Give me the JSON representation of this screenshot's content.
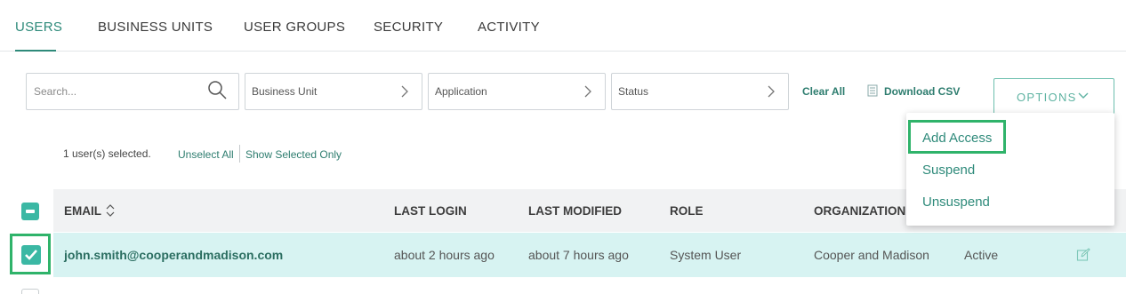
{
  "tabs": [
    {
      "label": "USERS",
      "active": true
    },
    {
      "label": "BUSINESS UNITS",
      "active": false
    },
    {
      "label": "USER GROUPS",
      "active": false
    },
    {
      "label": "SECURITY",
      "active": false
    },
    {
      "label": "ACTIVITY",
      "active": false
    }
  ],
  "filters": {
    "search_placeholder": "Search...",
    "business_unit": "Business Unit",
    "application": "Application",
    "status": "Status",
    "clear_all": "Clear All",
    "download_csv": "Download CSV",
    "options": "OPTIONS"
  },
  "options_menu": {
    "items": [
      "Add Access",
      "Suspend",
      "Unsuspend"
    ]
  },
  "selection": {
    "count_text": "1 user(s) selected.",
    "unselect_all": "Unselect All",
    "show_selected_only": "Show Selected Only"
  },
  "table": {
    "columns": [
      "EMAIL",
      "LAST LOGIN",
      "LAST MODIFIED",
      "ROLE",
      "ORGANIZATION"
    ],
    "rows": [
      {
        "email": "john.smith@cooperandmadison.com",
        "last_login": "about 2 hours ago",
        "last_modified": "about 7 hours ago",
        "role": "System User",
        "organization": "Cooper and Madison",
        "status": "Active",
        "selected": true
      }
    ]
  },
  "icons": {
    "search": "search-icon",
    "chevron": "chevron-right-icon",
    "csv": "document-icon",
    "caret": "chevron-down-icon",
    "sort": "sort-icon",
    "edit": "edit-icon",
    "check": "checkmark-icon"
  },
  "colors": {
    "accent": "#2e8a7a",
    "checkbox": "#3bb8a4",
    "row_selected": "#d7f3f2",
    "highlight": "#2fb36a"
  }
}
